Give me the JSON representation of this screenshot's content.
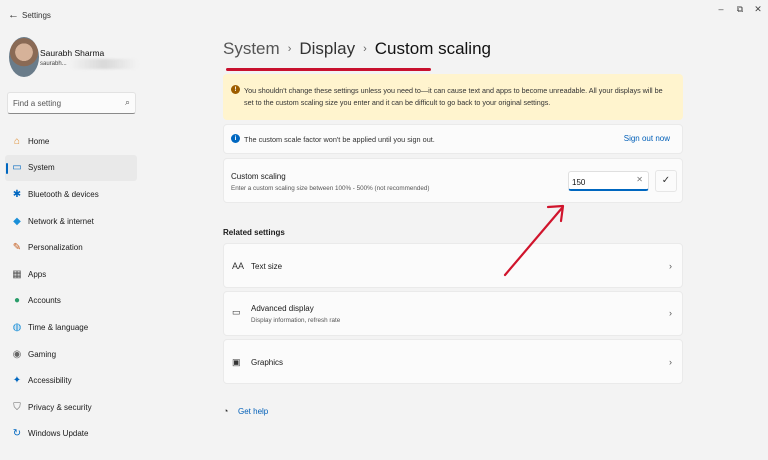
{
  "window": {
    "title": "Settings",
    "back_glyph": "←",
    "minimize_glyph": "–",
    "maximize_glyph": "⧉",
    "close_glyph": "✕"
  },
  "profile": {
    "name": "Saurabh Sharma",
    "email": "saurabh..."
  },
  "search": {
    "placeholder": "Find a setting",
    "icon_glyph": "⌕"
  },
  "sidebar": {
    "items": [
      {
        "label": "Home",
        "icon": "home-icon",
        "glyph": "⌂",
        "color": "#e08a2a"
      },
      {
        "label": "System",
        "icon": "system-icon",
        "glyph": "▭",
        "color": "#0067c0",
        "active": true
      },
      {
        "label": "Bluetooth & devices",
        "icon": "bluetooth-icon",
        "glyph": "✱",
        "color": "#0067c0"
      },
      {
        "label": "Network & internet",
        "icon": "network-icon",
        "glyph": "◆",
        "color": "#1a8fd8"
      },
      {
        "label": "Personalization",
        "icon": "brush-icon",
        "glyph": "✎",
        "color": "#c45a1a"
      },
      {
        "label": "Apps",
        "icon": "apps-icon",
        "glyph": "▦",
        "color": "#555555"
      },
      {
        "label": "Accounts",
        "icon": "accounts-icon",
        "glyph": "●",
        "color": "#2a9d6a"
      },
      {
        "label": "Time & language",
        "icon": "globe-icon",
        "glyph": "◍",
        "color": "#1a8fd8"
      },
      {
        "label": "Gaming",
        "icon": "gaming-icon",
        "glyph": "◉",
        "color": "#666666"
      },
      {
        "label": "Accessibility",
        "icon": "accessibility-icon",
        "glyph": "✦",
        "color": "#0067c0"
      },
      {
        "label": "Privacy & security",
        "icon": "shield-icon",
        "glyph": "⛉",
        "color": "#666666"
      },
      {
        "label": "Windows Update",
        "icon": "update-icon",
        "glyph": "↻",
        "color": "#0067c0"
      }
    ]
  },
  "breadcrumb": {
    "level1": "System",
    "level2": "Display",
    "level3": "Custom scaling",
    "separator": "›"
  },
  "warning": {
    "icon_glyph": "!",
    "text": "You shouldn't change these settings unless you need to—it can cause text and apps to become unreadable. All your displays will be set to the custom scaling size you enter and it can be difficult to go back to your original settings."
  },
  "info": {
    "icon_glyph": "i",
    "text": "The custom scale factor won't be applied until you sign out.",
    "link": "Sign out now"
  },
  "custom_scaling": {
    "title": "Custom scaling",
    "subtitle": "Enter a custom scaling size between 100% - 500% (not recommended)",
    "value": "150",
    "clear_glyph": "✕",
    "confirm_glyph": "✓"
  },
  "related": {
    "title": "Related settings",
    "items": [
      {
        "label": "Text size",
        "sub": "",
        "glyph": "A͏A"
      },
      {
        "label": "Advanced display",
        "sub": "Display information, refresh rate",
        "glyph": "▭"
      },
      {
        "label": "Graphics",
        "sub": "",
        "glyph": "▣"
      }
    ],
    "chevron": "›"
  },
  "help": {
    "label": "Get help",
    "glyph": "◔"
  },
  "annotation": {
    "arrow_color": "#d0142c"
  }
}
